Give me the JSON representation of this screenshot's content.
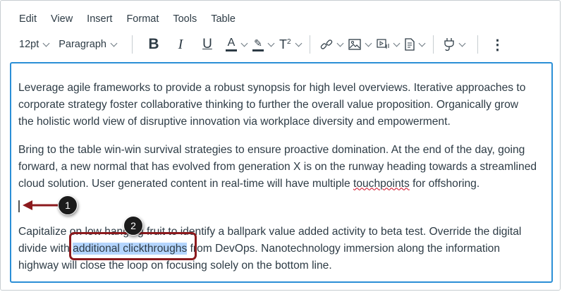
{
  "menu": [
    "Edit",
    "View",
    "Insert",
    "Format",
    "Tools",
    "Table"
  ],
  "toolbar": {
    "font_size": "12pt",
    "block_format": "Paragraph",
    "icons": [
      "bold-icon",
      "italic-icon",
      "underline-icon",
      "text-color-icon",
      "highlight-color-icon",
      "superscript-icon",
      "link-icon",
      "image-icon",
      "media-icon",
      "document-icon",
      "plugin-icon",
      "more-icon"
    ]
  },
  "content": {
    "p1": [
      "Leverage agile frameworks to provide a robust synopsis for high level overviews. Iterative approaches to",
      "corporate strategy foster collaborative thinking to further the overall value proposition. Organically grow",
      "the holistic world view of disruptive innovation via workplace diversity and empowerment."
    ],
    "p2": [
      "Bring to the table win-win survival strategies to ensure proactive domination. At the end of the day, going",
      "forward, a new normal that has evolved from generation X is on the runway heading towards a streamlined",
      "cloud solution. User generated content in real-time will have multiple ",
      "touchpoints",
      " for offshoring."
    ],
    "p3": [
      "Capitalize on low hanging fruit to identify a ballpark value added activity to beta test. Override the digital",
      "divide with ",
      "additional clickthroughs",
      " from DevOps. Nanotechnology immersion along the information",
      "highway will close the loop on focusing solely on the bottom line."
    ]
  },
  "callouts": [
    "1",
    "2"
  ],
  "colors": {
    "accent": "#2b8fd6",
    "callout_red": "#8c1a1e",
    "selection": "#b4d5fe"
  }
}
